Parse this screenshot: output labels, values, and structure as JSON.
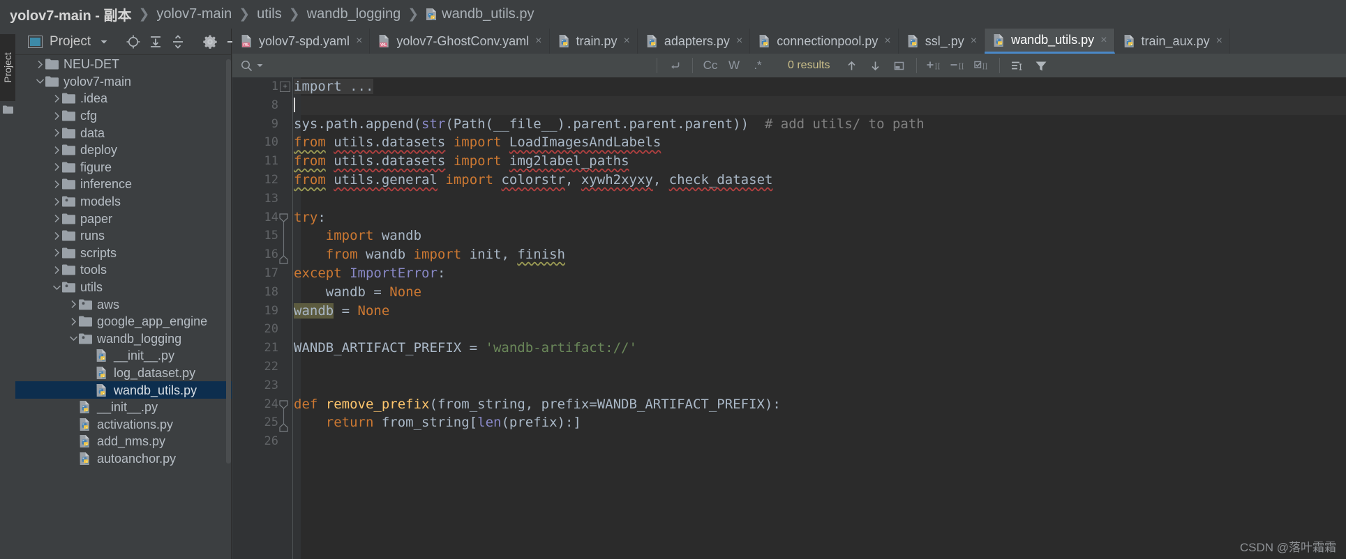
{
  "breadcrumb": {
    "items": [
      {
        "label": "yolov7-main - 副本",
        "bold": true
      },
      {
        "label": "yolov7-main",
        "bold": false
      },
      {
        "label": "utils",
        "bold": false
      },
      {
        "label": "wandb_logging",
        "bold": false
      }
    ],
    "separator": "❯",
    "file": "wandb_utils.py",
    "file_icon": "python-file-icon"
  },
  "toolstrip": {
    "project_label": "Project",
    "icon": "folder-icon"
  },
  "project_panel": {
    "title": "Project",
    "chevron": "chevron-down-icon",
    "icons": [
      "locate-icon",
      "expand-all-icon",
      "collapse-all-icon",
      "gear-icon",
      "hide-icon"
    ],
    "tree": [
      {
        "indent": 1,
        "arrow": "right",
        "icon": "folder",
        "label": "NEU-DET",
        "selected": false
      },
      {
        "indent": 1,
        "arrow": "down",
        "icon": "folder",
        "label": "yolov7-main",
        "selected": false
      },
      {
        "indent": 2,
        "arrow": "right",
        "icon": "folder",
        "label": ".idea",
        "selected": false
      },
      {
        "indent": 2,
        "arrow": "right",
        "icon": "folder",
        "label": "cfg",
        "selected": false
      },
      {
        "indent": 2,
        "arrow": "right",
        "icon": "folder",
        "label": "data",
        "selected": false
      },
      {
        "indent": 2,
        "arrow": "right",
        "icon": "folder",
        "label": "deploy",
        "selected": false
      },
      {
        "indent": 2,
        "arrow": "right",
        "icon": "folder",
        "label": "figure",
        "selected": false
      },
      {
        "indent": 2,
        "arrow": "right",
        "icon": "folder",
        "label": "inference",
        "selected": false
      },
      {
        "indent": 2,
        "arrow": "right",
        "icon": "package",
        "label": "models",
        "selected": false
      },
      {
        "indent": 2,
        "arrow": "right",
        "icon": "folder",
        "label": "paper",
        "selected": false
      },
      {
        "indent": 2,
        "arrow": "right",
        "icon": "folder",
        "label": "runs",
        "selected": false
      },
      {
        "indent": 2,
        "arrow": "right",
        "icon": "folder",
        "label": "scripts",
        "selected": false
      },
      {
        "indent": 2,
        "arrow": "right",
        "icon": "folder",
        "label": "tools",
        "selected": false
      },
      {
        "indent": 2,
        "arrow": "down",
        "icon": "package",
        "label": "utils",
        "selected": false
      },
      {
        "indent": 3,
        "arrow": "right",
        "icon": "package",
        "label": "aws",
        "selected": false
      },
      {
        "indent": 3,
        "arrow": "right",
        "icon": "folder",
        "label": "google_app_engine",
        "selected": false
      },
      {
        "indent": 3,
        "arrow": "down",
        "icon": "package",
        "label": "wandb_logging",
        "selected": false
      },
      {
        "indent": 4,
        "arrow": "none",
        "icon": "python",
        "label": "__init__.py",
        "selected": false
      },
      {
        "indent": 4,
        "arrow": "none",
        "icon": "python",
        "label": "log_dataset.py",
        "selected": false
      },
      {
        "indent": 4,
        "arrow": "none",
        "icon": "python",
        "label": "wandb_utils.py",
        "selected": true
      },
      {
        "indent": 3,
        "arrow": "none",
        "icon": "python",
        "label": "__init__.py",
        "selected": false
      },
      {
        "indent": 3,
        "arrow": "none",
        "icon": "python",
        "label": "activations.py",
        "selected": false
      },
      {
        "indent": 3,
        "arrow": "none",
        "icon": "python",
        "label": "add_nms.py",
        "selected": false
      },
      {
        "indent": 3,
        "arrow": "none",
        "icon": "python",
        "label": "autoanchor.py",
        "selected": false
      }
    ]
  },
  "editor_tabs": [
    {
      "label": "yolov7-spd.yaml",
      "icon": "yaml-file-icon",
      "active": false,
      "close": "×"
    },
    {
      "label": "yolov7-GhostConv.yaml",
      "icon": "yaml-file-icon",
      "active": false,
      "close": "×"
    },
    {
      "label": "train.py",
      "icon": "python-file-icon",
      "active": false,
      "close": "×"
    },
    {
      "label": "adapters.py",
      "icon": "python-file-icon",
      "active": false,
      "close": "×"
    },
    {
      "label": "connectionpool.py",
      "icon": "python-file-icon",
      "active": false,
      "close": "×"
    },
    {
      "label": "ssl_.py",
      "icon": "python-file-icon",
      "active": false,
      "close": "×"
    },
    {
      "label": "wandb_utils.py",
      "icon": "python-file-icon",
      "active": true,
      "close": "×"
    },
    {
      "label": "train_aux.py",
      "icon": "python-file-icon",
      "active": false,
      "close": "×"
    }
  ],
  "findbar": {
    "search_value": "",
    "search_placeholder": "",
    "search_icon": "magnifier-icon",
    "history_chevron": "chevron-down-icon",
    "regex_newline_icon": "multiline-icon",
    "match_case": "Cc",
    "words": "W",
    "regex": ".*",
    "results": "0 results",
    "prev_icon": "arrow-up-icon",
    "next_icon": "arrow-down-icon",
    "select_all_icon": "open-in-new-icon",
    "add_all_icon": "add-selection-icon",
    "remove_icon": "remove-selection-icon",
    "select_occurrences_icon": "select-all-occurrences-icon",
    "preserve_case_icon": "filter-lines-icon",
    "filter_icon": "funnel-icon"
  },
  "editor": {
    "lines": [
      {
        "num": "1",
        "fold": "plus",
        "segments": [
          {
            "t": "import ...",
            "c": "plain import-collapsed"
          }
        ]
      },
      {
        "num": "8",
        "fold": "none",
        "caret": true,
        "current": true,
        "segments": []
      },
      {
        "num": "9",
        "fold": "none",
        "segments": [
          {
            "t": "sys.path.append(",
            "c": "plain"
          },
          {
            "t": "str",
            "c": "builtin"
          },
          {
            "t": "(Path(__file__).parent.parent.parent))",
            "c": "plain"
          },
          {
            "t": "  # add utils/ to path",
            "c": "cmt"
          }
        ]
      },
      {
        "num": "10",
        "fold": "none",
        "segments": [
          {
            "t": "from",
            "c": "kw wavy-grn"
          },
          {
            "t": " ",
            "c": "plain"
          },
          {
            "t": "utils.datasets",
            "c": "plain wavy-red"
          },
          {
            "t": " ",
            "c": "plain"
          },
          {
            "t": "import",
            "c": "kw"
          },
          {
            "t": " ",
            "c": "plain"
          },
          {
            "t": "LoadImagesAndLabels",
            "c": "plain wavy-red"
          }
        ]
      },
      {
        "num": "11",
        "fold": "none",
        "segments": [
          {
            "t": "from",
            "c": "kw wavy-grn"
          },
          {
            "t": " ",
            "c": "plain"
          },
          {
            "t": "utils.datasets",
            "c": "plain wavy-red"
          },
          {
            "t": " ",
            "c": "plain"
          },
          {
            "t": "import",
            "c": "kw"
          },
          {
            "t": " ",
            "c": "plain"
          },
          {
            "t": "img2label_paths",
            "c": "plain wavy-red"
          }
        ]
      },
      {
        "num": "12",
        "fold": "none",
        "segments": [
          {
            "t": "from",
            "c": "kw wavy-grn"
          },
          {
            "t": " ",
            "c": "plain"
          },
          {
            "t": "utils.general",
            "c": "plain wavy-red"
          },
          {
            "t": " ",
            "c": "plain"
          },
          {
            "t": "import",
            "c": "kw"
          },
          {
            "t": " ",
            "c": "plain"
          },
          {
            "t": "colorstr",
            "c": "plain wavy-red"
          },
          {
            "t": ", ",
            "c": "plain"
          },
          {
            "t": "xywh2xyxy",
            "c": "plain wavy-red"
          },
          {
            "t": ", ",
            "c": "plain"
          },
          {
            "t": "check_dataset",
            "c": "plain wavy-red"
          }
        ]
      },
      {
        "num": "13",
        "fold": "none",
        "segments": []
      },
      {
        "num": "14",
        "fold": "minus-top",
        "segments": [
          {
            "t": "try",
            "c": "kw"
          },
          {
            "t": ":",
            "c": "plain"
          }
        ]
      },
      {
        "num": "15",
        "fold": "bar",
        "segments": [
          {
            "t": "    ",
            "c": "plain"
          },
          {
            "t": "import",
            "c": "kw"
          },
          {
            "t": " wandb",
            "c": "plain"
          }
        ]
      },
      {
        "num": "16",
        "fold": "minus-bot",
        "segments": [
          {
            "t": "    ",
            "c": "plain"
          },
          {
            "t": "from",
            "c": "kw"
          },
          {
            "t": " wandb ",
            "c": "plain"
          },
          {
            "t": "import",
            "c": "kw"
          },
          {
            "t": " init, ",
            "c": "plain"
          },
          {
            "t": "finish",
            "c": "plain wavy-grn"
          }
        ]
      },
      {
        "num": "17",
        "fold": "none",
        "segments": [
          {
            "t": "except",
            "c": "kw"
          },
          {
            "t": " ",
            "c": "plain"
          },
          {
            "t": "ImportError",
            "c": "builtin"
          },
          {
            "t": ":",
            "c": "plain"
          }
        ]
      },
      {
        "num": "18",
        "fold": "none",
        "segments": [
          {
            "t": "    wandb = ",
            "c": "plain"
          },
          {
            "t": "None",
            "c": "kw"
          }
        ]
      },
      {
        "num": "19",
        "fold": "none",
        "segments": [
          {
            "t": "wandb",
            "c": "plain occ"
          },
          {
            "t": " = ",
            "c": "plain"
          },
          {
            "t": "None",
            "c": "kw"
          }
        ]
      },
      {
        "num": "20",
        "fold": "none",
        "segments": []
      },
      {
        "num": "21",
        "fold": "none",
        "segments": [
          {
            "t": "WANDB_ARTIFACT_PREFIX = ",
            "c": "plain"
          },
          {
            "t": "'wandb-artifact://'",
            "c": "str"
          }
        ]
      },
      {
        "num": "22",
        "fold": "none",
        "segments": []
      },
      {
        "num": "23",
        "fold": "none",
        "segments": []
      },
      {
        "num": "24",
        "fold": "minus-top",
        "segments": [
          {
            "t": "def",
            "c": "kw"
          },
          {
            "t": " ",
            "c": "plain"
          },
          {
            "t": "remove_prefix",
            "c": "fn"
          },
          {
            "t": "(from_string, prefix=WANDB_ARTIFACT_PREFIX):",
            "c": "plain"
          }
        ]
      },
      {
        "num": "25",
        "fold": "minus-bot",
        "segments": [
          {
            "t": "    ",
            "c": "plain"
          },
          {
            "t": "return",
            "c": "kw"
          },
          {
            "t": " from_string[",
            "c": "plain"
          },
          {
            "t": "len",
            "c": "builtin"
          },
          {
            "t": "(prefix):]",
            "c": "plain"
          }
        ]
      },
      {
        "num": "26",
        "fold": "none",
        "segments": []
      }
    ]
  },
  "watermark": "CSDN @落叶霜霜"
}
